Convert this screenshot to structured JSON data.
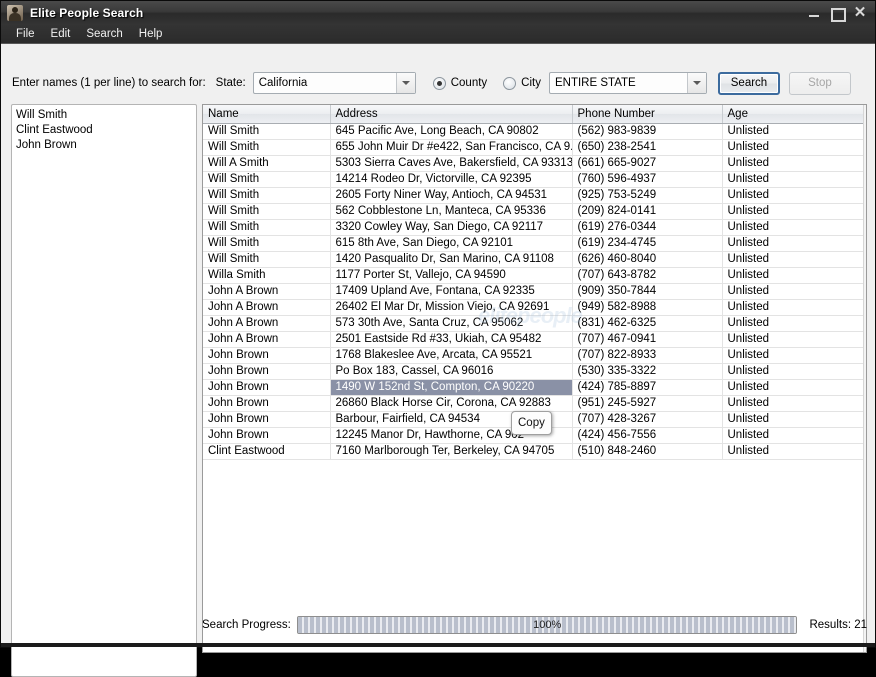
{
  "window": {
    "title": "Elite People Search",
    "icon": "detective-person-icon",
    "buttons": {
      "minimize": "–",
      "maximize": "□",
      "close": "✕"
    }
  },
  "menu": {
    "items": [
      "File",
      "Edit",
      "Search",
      "Help"
    ]
  },
  "toolbar": {
    "names_label": "Enter names (1 per line) to search for:",
    "state_label": "State:",
    "state_value": "California",
    "scope": {
      "county_label": "County",
      "city_label": "City",
      "selected": "county"
    },
    "county_value": "ENTIRE STATE",
    "search_label": "Search",
    "stop_label": "Stop"
  },
  "names_input": {
    "lines": [
      "Will Smith",
      "Clint Eastwood",
      "John Brown"
    ]
  },
  "results": {
    "columns": [
      "Name",
      "Address",
      "Phone Number",
      "Age"
    ],
    "selected_cell": {
      "row": 17,
      "column": "Address"
    },
    "copy_popup_label": "Copy",
    "watermark": "elitepeople",
    "rows": [
      [
        "Will Smith",
        "645 Pacific Ave, Long Beach, CA 90802",
        "(562) 983-9839",
        "Unlisted"
      ],
      [
        "Will Smith",
        "655 John Muir Dr #e422, San Francisco, CA 9...",
        "(650) 238-2541",
        "Unlisted"
      ],
      [
        "Will A Smith",
        "5303 Sierra Caves Ave, Bakersfield, CA 93313",
        "(661) 665-9027",
        "Unlisted"
      ],
      [
        "Will Smith",
        "14214 Rodeo Dr, Victorville, CA 92395",
        "(760) 596-4937",
        "Unlisted"
      ],
      [
        "Will Smith",
        "2605 Forty Niner Way, Antioch, CA 94531",
        "(925) 753-5249",
        "Unlisted"
      ],
      [
        "Will Smith",
        "562 Cobblestone Ln, Manteca, CA 95336",
        "(209) 824-0141",
        "Unlisted"
      ],
      [
        "Will Smith",
        "3320 Cowley Way, San Diego, CA 92117",
        "(619) 276-0344",
        "Unlisted"
      ],
      [
        "Will Smith",
        "615 8th Ave, San Diego, CA 92101",
        "(619) 234-4745",
        "Unlisted"
      ],
      [
        "Will Smith",
        "1420 Pasqualito Dr, San Marino, CA 91108",
        "(626) 460-8040",
        "Unlisted"
      ],
      [
        "Willa Smith",
        "1177 Porter St, Vallejo, CA 94590",
        "(707) 643-8782",
        "Unlisted"
      ],
      [
        "John A Brown",
        "17409 Upland Ave, Fontana, CA 92335",
        "(909) 350-7844",
        "Unlisted"
      ],
      [
        "John A Brown",
        "26402 El Mar Dr, Mission Viejo, CA 92691",
        "(949) 582-8988",
        "Unlisted"
      ],
      [
        "John A Brown",
        "573 30th Ave, Santa Cruz, CA 95062",
        "(831) 462-6325",
        "Unlisted"
      ],
      [
        "John A Brown",
        "2501 Eastside Rd #33, Ukiah, CA 95482",
        "(707) 467-0941",
        "Unlisted"
      ],
      [
        "John Brown",
        "1768 Blakeslee Ave, Arcata, CA 95521",
        "(707) 822-8933",
        "Unlisted"
      ],
      [
        "John Brown",
        "Po Box 183, Cassel, CA 96016",
        "(530) 335-3322",
        "Unlisted"
      ],
      [
        "John Brown",
        "1490 W 152nd St, Compton, CA 90220",
        "(424) 785-8897",
        "Unlisted"
      ],
      [
        "John Brown",
        "26860 Black Horse Cir, Corona, CA 92883",
        "(951) 245-5927",
        "Unlisted"
      ],
      [
        "John Brown",
        "Barbour, Fairfield, CA 94534",
        "(707) 428-3267",
        "Unlisted"
      ],
      [
        "John Brown",
        "12245 Manor Dr, Hawthorne, CA 902",
        "(424) 456-7556",
        "Unlisted"
      ],
      [
        "Clint Eastwood",
        "7160 Marlborough Ter, Berkeley, CA 94705",
        "(510) 848-2460",
        "Unlisted"
      ]
    ]
  },
  "status": {
    "progress_label": "Search Progress:",
    "progress_percent": "100%",
    "progress_value": 100,
    "results_label": "Results: 21"
  },
  "colors": {
    "titlebar": "#3a3a3a",
    "client_bg": "#f0f0f0",
    "selection": "#8a91a6",
    "default_button_border": "#3c6b9e"
  }
}
